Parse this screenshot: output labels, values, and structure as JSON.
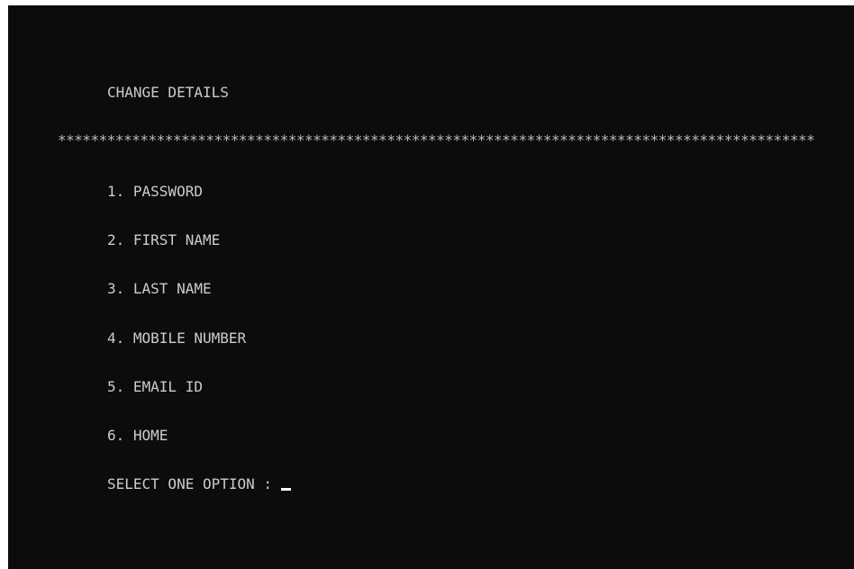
{
  "screen": {
    "title": "CHANGE DETAILS",
    "separator": "********************************************************************************************",
    "menu": [
      {
        "label": "1. PASSWORD"
      },
      {
        "label": "2. FIRST NAME"
      },
      {
        "label": "3. LAST NAME"
      },
      {
        "label": "4. MOBILE NUMBER"
      },
      {
        "label": "5. EMAIL ID"
      },
      {
        "label": "6. HOME"
      }
    ],
    "prompt": "SELECT ONE OPTION : "
  },
  "colors": {
    "background": "#0c0c0c",
    "text": "#cccccc",
    "cursor": "#ffffff"
  }
}
